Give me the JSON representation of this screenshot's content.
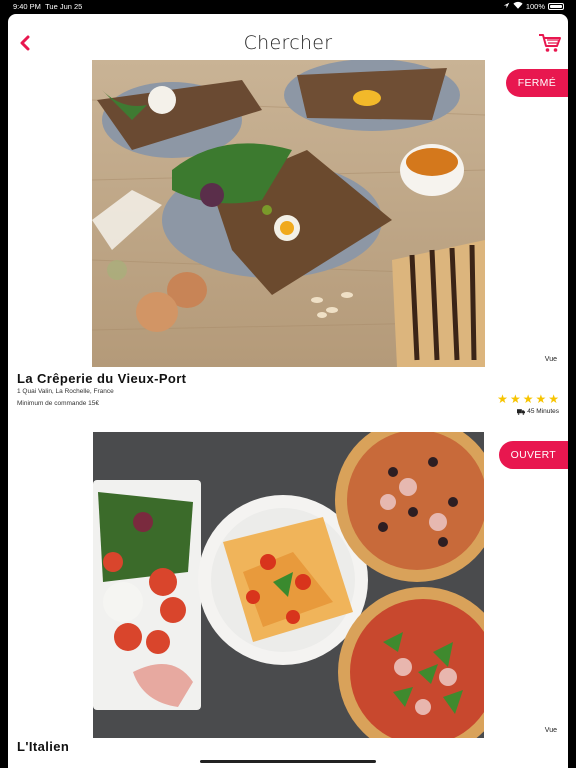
{
  "status_bar": {
    "time": "9:40 PM",
    "date": "Tue Jun 25",
    "battery": "100%",
    "icons": [
      "wifi-icon",
      "location-icon",
      "battery-icon"
    ]
  },
  "header": {
    "title": "Chercher",
    "back_icon": "chevron-left-icon",
    "cart_icon": "cart-icon"
  },
  "colors": {
    "accent": "#e8174f",
    "star": "#f7c400"
  },
  "restaurants": [
    {
      "name": "La Crêperie du Vieux-Port",
      "address": "1 Quai Valin, La Rochelle, France",
      "minimum": "Minimum de commande 15€",
      "status": "FERMÉ",
      "vue": "Vue",
      "rating": 5,
      "delivery_time": "45 Minutes",
      "photo": "crepes-galettes"
    },
    {
      "name": "L'Italien",
      "status": "OUVERT",
      "vue": "Vue",
      "photo": "pizza-ravioli-antipasti"
    }
  ]
}
